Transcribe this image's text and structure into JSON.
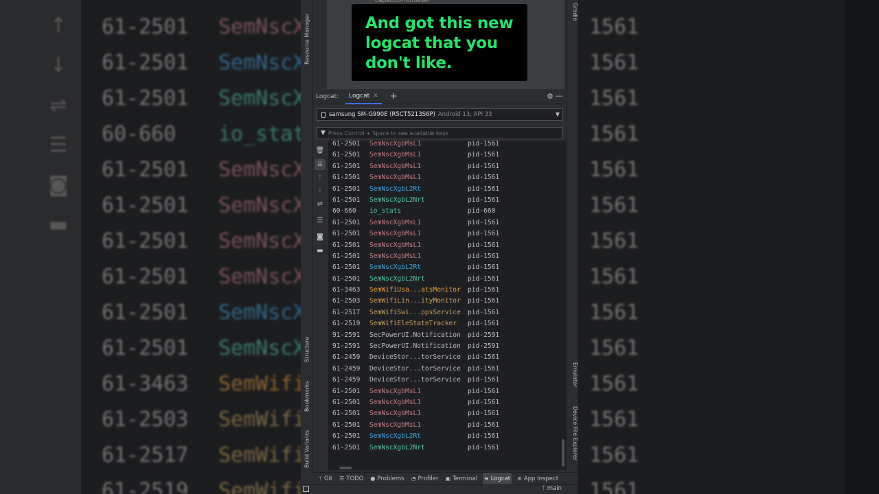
{
  "overlay": {
    "caption": "And got this new logcat that you don't like."
  },
  "project": {
    "item": "capacitor-browser"
  },
  "left_tabs": {
    "resource_manager": "Resource Manager",
    "structure": "Structure",
    "bookmarks": "Bookmarks",
    "build_variants": "Build Variants"
  },
  "right_tabs": {
    "gradle": "Gradle",
    "emulator": "Emulator",
    "device_file_explorer": "Device File Explorer"
  },
  "logcat": {
    "label": "Logcat:",
    "tab": "Logcat",
    "device_name": "samsung SM-G990E (R5CT5213S6P)",
    "device_sub": "Android 13, API 33",
    "filter_placeholder": "Press Control + Space to see available keys"
  },
  "icons": {
    "trash": "trash-icon",
    "scroll_end": "scroll-to-end-icon",
    "up": "arrow-up-icon",
    "down": "arrow-down-icon",
    "wrap": "soft-wrap-icon",
    "format": "format-icon",
    "screenshot": "camera-icon",
    "record": "video-icon"
  },
  "colors": {
    "pink": "#c77c8a",
    "blue": "#3ea2e0",
    "teal": "#52c7a6",
    "orange": "#e99a3a",
    "tan": "#c9a15f",
    "gray": "#bcbec4",
    "caption": "#27e36b",
    "accent": "#3574f0"
  },
  "log_rows": [
    {
      "pid": "61-2501",
      "tag": "SemNscXgbMsL1",
      "color": "#c77c8a",
      "proc": "pid-1561"
    },
    {
      "pid": "61-2501",
      "tag": "SemNscXgbMsL1",
      "color": "#c77c8a",
      "proc": "pid-1561"
    },
    {
      "pid": "61-2501",
      "tag": "SemNscXgbMsL1",
      "color": "#c77c8a",
      "proc": "pid-1561"
    },
    {
      "pid": "61-2501",
      "tag": "SemNscXgbMsL1",
      "color": "#c77c8a",
      "proc": "pid-1561"
    },
    {
      "pid": "61-2501",
      "tag": "SemNscXgbL2Rt",
      "color": "#3ea2e0",
      "proc": "pid-1561"
    },
    {
      "pid": "61-2501",
      "tag": "SemNscXgbL2Nrt",
      "color": "#52c7a6",
      "proc": "pid-1561"
    },
    {
      "pid": "60-660",
      "tag": "io_stats",
      "color": "#52c7a6",
      "proc": "pid-660"
    },
    {
      "pid": "61-2501",
      "tag": "SemNscXgbMsL1",
      "color": "#c77c8a",
      "proc": "pid-1561"
    },
    {
      "pid": "61-2501",
      "tag": "SemNscXgbMsL1",
      "color": "#c77c8a",
      "proc": "pid-1561"
    },
    {
      "pid": "61-2501",
      "tag": "SemNscXgbMsL1",
      "color": "#c77c8a",
      "proc": "pid-1561"
    },
    {
      "pid": "61-2501",
      "tag": "SemNscXgbMsL1",
      "color": "#c77c8a",
      "proc": "pid-1561"
    },
    {
      "pid": "61-2501",
      "tag": "SemNscXgbL2Rt",
      "color": "#3ea2e0",
      "proc": "pid-1561"
    },
    {
      "pid": "61-2501",
      "tag": "SemNscXgbL2Nrt",
      "color": "#52c7a6",
      "proc": "pid-1561"
    },
    {
      "pid": "61-3463",
      "tag": "SemWifiUsa...atsMonitor",
      "color": "#e99a3a",
      "proc": "pid-1561"
    },
    {
      "pid": "61-2503",
      "tag": "SemWifiLin...ityMonitor",
      "color": "#c9a15f",
      "proc": "pid-1561"
    },
    {
      "pid": "61-2517",
      "tag": "SemWifiSwi...ppsService",
      "color": "#c9a15f",
      "proc": "pid-1561"
    },
    {
      "pid": "61-2519",
      "tag": "SemWifiEleStateTracker",
      "color": "#c9a15f",
      "proc": "pid-1561"
    },
    {
      "pid": "91-2591",
      "tag": "SecPowerUI.Notification",
      "color": "#bcbec4",
      "proc": "pid-2591"
    },
    {
      "pid": "91-2591",
      "tag": "SecPowerUI.Notification",
      "color": "#bcbec4",
      "proc": "pid-2591"
    },
    {
      "pid": "61-2459",
      "tag": "DeviceStor...torService",
      "color": "#bcbec4",
      "proc": "pid-1561"
    },
    {
      "pid": "61-2459",
      "tag": "DeviceStor...torService",
      "color": "#bcbec4",
      "proc": "pid-1561"
    },
    {
      "pid": "61-2459",
      "tag": "DeviceStor...torService",
      "color": "#bcbec4",
      "proc": "pid-1561"
    },
    {
      "pid": "61-2501",
      "tag": "SemNscXgbMsL1",
      "color": "#c77c8a",
      "proc": "pid-1561"
    },
    {
      "pid": "61-2501",
      "tag": "SemNscXgbMsL1",
      "color": "#c77c8a",
      "proc": "pid-1561"
    },
    {
      "pid": "61-2501",
      "tag": "SemNscXgbMsL1",
      "color": "#c77c8a",
      "proc": "pid-1561"
    },
    {
      "pid": "61-2501",
      "tag": "SemNscXgbMsL1",
      "color": "#c77c8a",
      "proc": "pid-1561"
    },
    {
      "pid": "61-2501",
      "tag": "SemNscXgbL2Rt",
      "color": "#3ea2e0",
      "proc": "pid-1561"
    },
    {
      "pid": "61-2501",
      "tag": "SemNscXgbL2Nrt",
      "color": "#52c7a6",
      "proc": "pid-1561"
    }
  ],
  "bottom_tabs": [
    {
      "label": "Git",
      "icon": "git-icon",
      "glyph": "ᛘ"
    },
    {
      "label": "TODO",
      "icon": "todo-icon",
      "glyph": "☰"
    },
    {
      "label": "Problems",
      "icon": "problems-icon",
      "glyph": "●"
    },
    {
      "label": "Profiler",
      "icon": "profiler-icon",
      "glyph": "◔"
    },
    {
      "label": "Terminal",
      "icon": "terminal-icon",
      "glyph": "▣"
    },
    {
      "label": "Logcat",
      "icon": "logcat-icon",
      "glyph": "≡",
      "active": true
    },
    {
      "label": "App Inspect",
      "icon": "app-inspection-icon",
      "glyph": "⊛"
    }
  ],
  "status": {
    "branch": "main"
  },
  "background": {
    "rows": [
      {
        "pid": "61-2501",
        "tag": "SemNscX",
        "color": "#c77c8a"
      },
      {
        "pid": "61-2501",
        "tag": "SemNscX",
        "color": "#3ea2e0"
      },
      {
        "pid": "61-2501",
        "tag": "SemNscX",
        "color": "#52c7a6"
      },
      {
        "pid": "60-660",
        "tag": "io_stat",
        "color": "#52c7a6"
      },
      {
        "pid": "61-2501",
        "tag": "SemNscX",
        "color": "#c77c8a"
      },
      {
        "pid": "61-2501",
        "tag": "SemNscX",
        "color": "#c77c8a"
      },
      {
        "pid": "61-2501",
        "tag": "SemNscX",
        "color": "#c77c8a"
      },
      {
        "pid": "61-2501",
        "tag": "SemNscX",
        "color": "#c77c8a"
      },
      {
        "pid": "61-2501",
        "tag": "SemNscX",
        "color": "#3ea2e0"
      },
      {
        "pid": "61-2501",
        "tag": "SemNscX",
        "color": "#52c7a6"
      },
      {
        "pid": "61-3463",
        "tag": "SemWifi",
        "color": "#e99a3a"
      },
      {
        "pid": "61-2503",
        "tag": "SemWifi",
        "color": "#c9a15f"
      },
      {
        "pid": "61-2517",
        "tag": "SemWifi",
        "color": "#c9a15f"
      },
      {
        "pid": "61-2519",
        "tag": "SemWifi",
        "color": "#c9a15f"
      }
    ],
    "right": [
      "1561",
      "1561",
      "1561",
      "1561",
      "1561",
      "1561",
      "1561",
      "1561",
      "1561",
      "1561",
      "1561",
      "1561",
      "1561",
      "1561"
    ]
  }
}
